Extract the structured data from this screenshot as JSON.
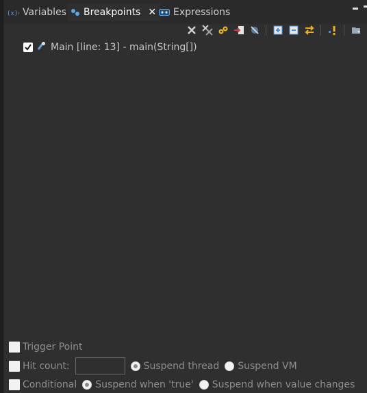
{
  "tabs": [
    {
      "label": "Variables",
      "icon": "variables-icon",
      "active": false
    },
    {
      "label": "Breakpoints",
      "icon": "breakpoints-icon",
      "active": true
    },
    {
      "label": "Expressions",
      "icon": "expressions-icon",
      "active": false
    }
  ],
  "close_symbol": "✕",
  "toolbar": [
    "remove-selected-breakpoints-icon",
    "remove-all-breakpoints-icon",
    "show-breakpoints-supported-icon",
    "go-to-file-icon",
    "skip-all-breakpoints-icon",
    "expand-all-icon",
    "collapse-all-icon",
    "link-with-debug-view-icon",
    "add-java-exception-breakpoint-icon",
    "view-menu-icon"
  ],
  "breakpoints": [
    {
      "label": "Main [line: 13] - main(String[])",
      "checked": true
    }
  ],
  "properties": {
    "trigger_point": "Trigger Point",
    "hit_count": "Hit count:",
    "suspend_thread": "Suspend thread",
    "suspend_vm": "Suspend VM",
    "conditional": "Conditional",
    "suspend_when_true": "Suspend when 'true'",
    "suspend_when_value_changes": "Suspend when value changes"
  },
  "colors": {
    "background": "#2f2f2f",
    "text": "#c8c8c8",
    "disabled_text": "#8e8e8e",
    "accent_blue": "#5ba7e8"
  }
}
